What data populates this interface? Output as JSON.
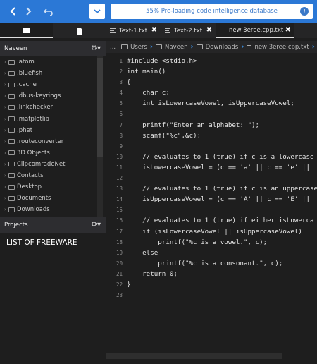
{
  "status": {
    "text": "55% Pre-loading code intelligence database",
    "warn_icon": "!"
  },
  "tabs": [
    {
      "label": "Text-1.txt",
      "close": "✖"
    },
    {
      "label": "Text-2.txt",
      "close": "✖"
    },
    {
      "label": "new 3eree.cpp.txt",
      "close": "✖"
    }
  ],
  "sidebar": {
    "places_header": "Naveen",
    "files": [
      ".atom",
      ".bluefish",
      ".cache",
      ".dbus-keyrings",
      ".linkchecker",
      ".matplotlib",
      ".phet",
      ".routeconverter",
      "3D Objects",
      "ClipcomradeNet",
      "Contacts",
      "Desktop",
      "Documents",
      "Downloads"
    ],
    "projects_header": "Projects",
    "projects_text": "LIST OF FREEWARE"
  },
  "breadcrumb": {
    "ellipsis": "...",
    "items": [
      "Users",
      "Naveen",
      "Downloads",
      "new 3eree.cpp.txt"
    ]
  },
  "editor": {
    "line_numbers": [
      "1",
      "2",
      "3",
      "4",
      "5",
      "6",
      "7",
      "8",
      "9",
      "10",
      "11",
      "12",
      "13",
      "14",
      "15",
      "16",
      "17",
      "18",
      "19",
      "20",
      "21",
      "22",
      "23"
    ],
    "lines": [
      "#include <stdio.h>",
      "int main()",
      "{",
      "    char c;",
      "    int isLowercaseVowel, isUppercaseVowel;",
      "",
      "    printf(\"Enter an alphabet: \");",
      "    scanf(\"%c\",&c);",
      "",
      "    // evaluates to 1 (true) if c is a lowercase",
      "    isLowercaseVowel = (c == 'a' || c == 'e' ||",
      "",
      "    // evaluates to 1 (true) if c is an uppercase",
      "    isUppercaseVowel = (c == 'A' || c == 'E' ||",
      "",
      "    // evaluates to 1 (true) if either isLowerca",
      "    if (isLowercaseVowel || isUppercaseVowel)",
      "        printf(\"%c is a vowel.\", c);",
      "    else",
      "        printf(\"%c is a consonant.\", c);",
      "    return 0;",
      "}",
      ""
    ]
  }
}
